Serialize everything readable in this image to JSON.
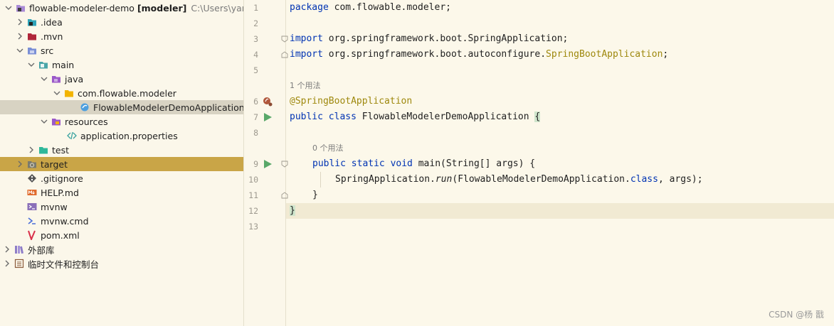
{
  "project_tree": {
    "root": {
      "name": "flowable-modeler-demo",
      "module": "[modeler]",
      "path": "C:\\Users\\yangy"
    },
    "items": [
      {
        "label": ".idea"
      },
      {
        "label": ".mvn"
      },
      {
        "label": "src"
      },
      {
        "label": "main"
      },
      {
        "label": "java"
      },
      {
        "label": "com.flowable.modeler"
      },
      {
        "label": "FlowableModelerDemoApplication"
      },
      {
        "label": "resources"
      },
      {
        "label": "application.properties"
      },
      {
        "label": "test"
      },
      {
        "label": "target"
      },
      {
        "label": ".gitignore"
      },
      {
        "label": "HELP.md"
      },
      {
        "label": "mvnw"
      },
      {
        "label": "mvnw.cmd"
      },
      {
        "label": "pom.xml"
      },
      {
        "label": "外部库"
      },
      {
        "label": "临时文件和控制台"
      }
    ]
  },
  "editor": {
    "line_numbers": [
      "1",
      "2",
      "3",
      "4",
      "5",
      "6",
      "7",
      "8",
      "9",
      "10",
      "11",
      "12",
      "13"
    ],
    "hints": {
      "usages_class": "1 个用法",
      "usages_method": "0 个用法"
    },
    "code": {
      "l1_kw": "package",
      "l1_rest": " com.flowable.modeler;",
      "l3_kw": "import",
      "l3_rest": " org.springframework.boot.SpringApplication;",
      "l4_kw": "import",
      "l4_rest": " org.springframework.boot.autoconfigure.",
      "l4_ann": "SpringBootApplication",
      "l4_end": ";",
      "l6_ann": "@SpringBootApplication",
      "l7_kw": "public class",
      "l7_name": " FlowableModelerDemoApplication ",
      "l7_brace": "{",
      "l9_kw": "public static void",
      "l9_rest": " main(String[] args) {",
      "l10_a": "SpringApplication.",
      "l10_b": "run",
      "l10_c": "(FlowableModelerDemoApplication.",
      "l10_kw": "class",
      "l10_d": ", args);",
      "l11": "}",
      "l12": "}"
    }
  },
  "watermark": "CSDN @杨 戬"
}
